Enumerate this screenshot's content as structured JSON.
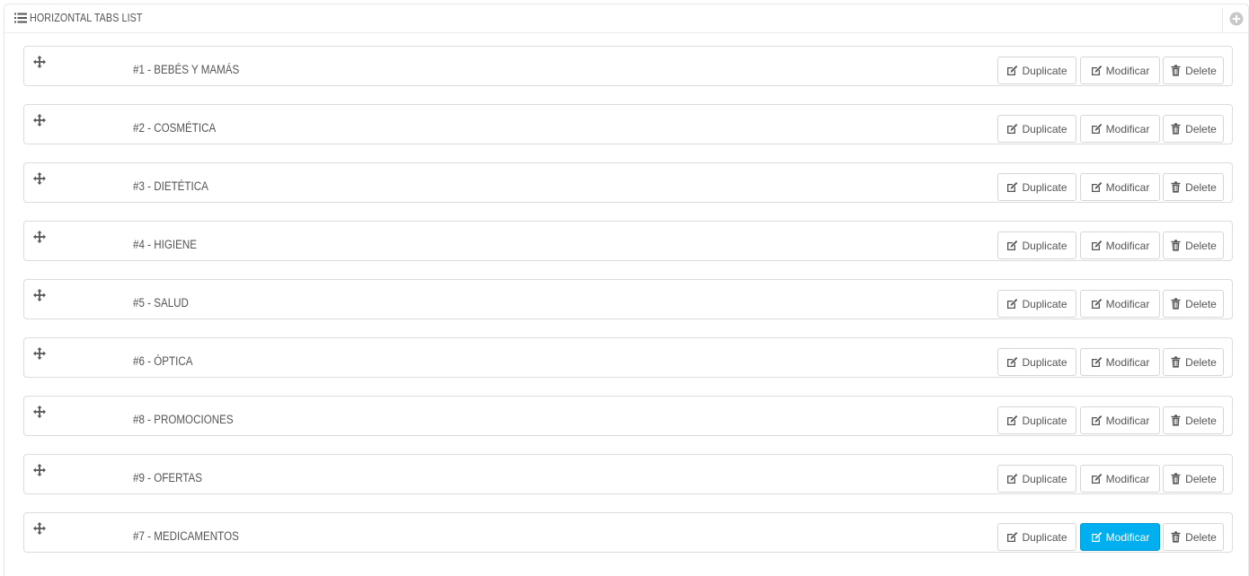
{
  "panel": {
    "title": "HORIZONTAL TABS LIST",
    "title_icon": "list-icon",
    "add_icon": "plus-circle-icon"
  },
  "buttons": {
    "duplicate_label": "Duplicate",
    "modify_label": "Modificar",
    "delete_label": "Delete"
  },
  "icons": {
    "move": "move-icon",
    "edit": "edit-icon",
    "trash": "trash-icon"
  },
  "colors": {
    "active_button": "#00aff0"
  },
  "tabs": [
    {
      "label": "#1 - BEBÉS Y MAMÁS",
      "modify_active": false
    },
    {
      "label": "#2 - COSMÉTICA",
      "modify_active": false
    },
    {
      "label": "#3 - DIETÉTICA",
      "modify_active": false
    },
    {
      "label": "#4 - HIGIENE",
      "modify_active": false
    },
    {
      "label": "#5 - SALUD",
      "modify_active": false
    },
    {
      "label": "#6 - ÓPTICA",
      "modify_active": false
    },
    {
      "label": "#8 - PROMOCIONES",
      "modify_active": false
    },
    {
      "label": "#9 - OFERTAS",
      "modify_active": false
    },
    {
      "label": "#7 - MEDICAMENTOS",
      "modify_active": true
    }
  ]
}
